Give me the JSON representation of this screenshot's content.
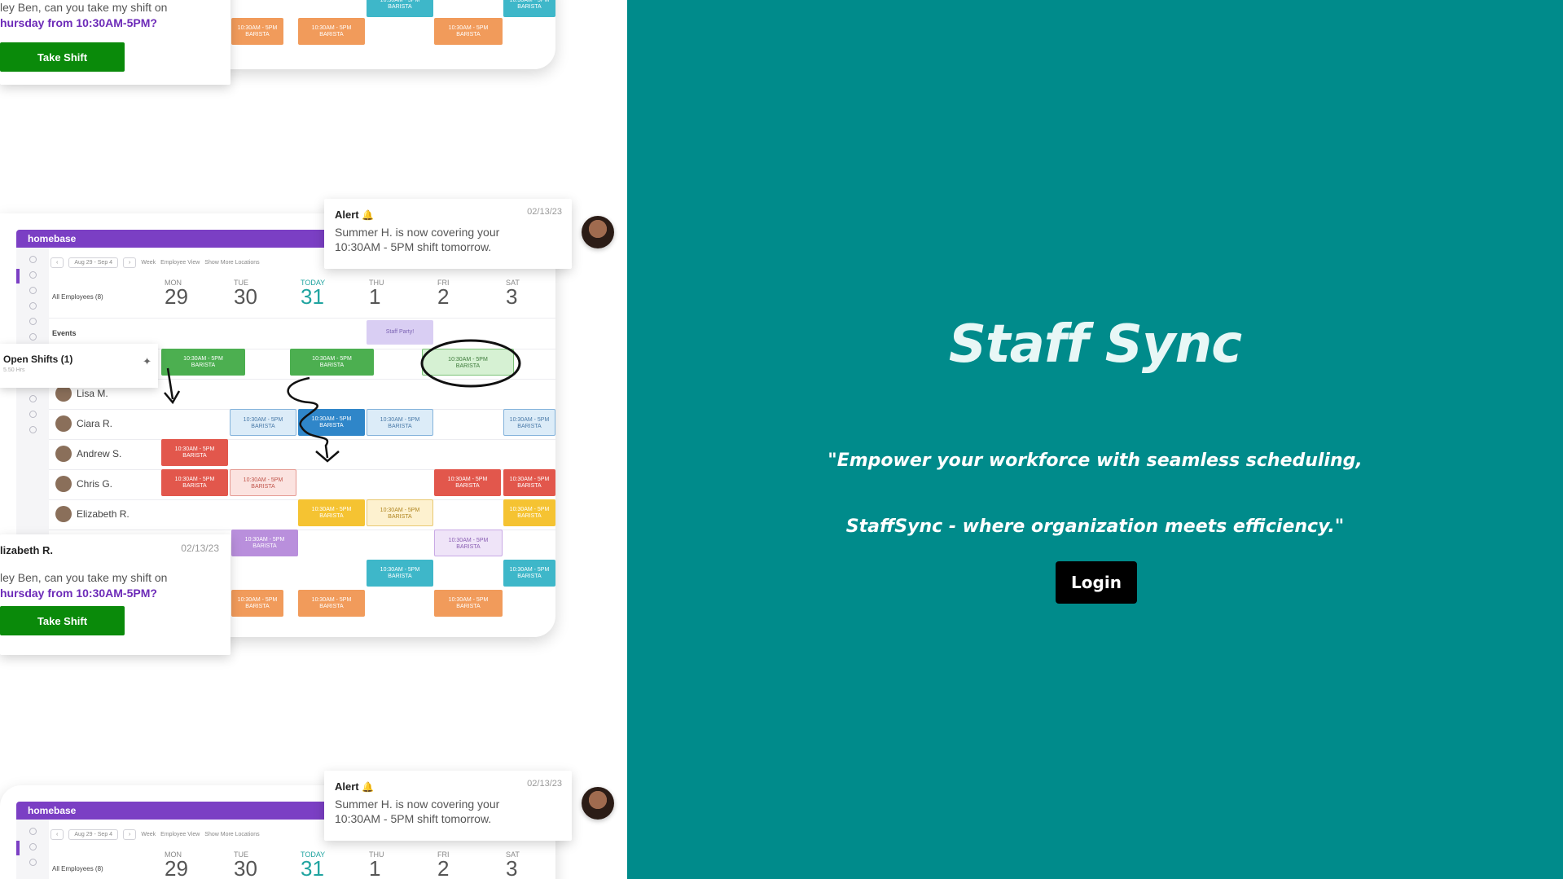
{
  "hero": {
    "title": "Staff Sync",
    "tagline_line1": "\"Empower your workforce with seamless scheduling,",
    "tagline_line2": "StaffSync - where organization meets efficiency.\"",
    "login_label": "Login"
  },
  "colors": {
    "hero_background": "#008b8b",
    "login_button": "#000000",
    "take_shift_button": "#0a8a0a",
    "homebase_brand": "#7b3fc4"
  },
  "collage": {
    "app_name": "homebase",
    "date_range": "Aug 29 - Sep 4",
    "view_week": "Week",
    "view_employee": "Employee View",
    "show_locations": "Show More Locations",
    "all_employees": "All Employees (8)",
    "events_label": "Events",
    "event_name": "Staff Party!",
    "open_shifts": "Open Shifts (1)",
    "open_shifts_hours": "5.50 Hrs",
    "days": [
      {
        "dow": "MON",
        "num": "29"
      },
      {
        "dow": "TUE",
        "num": "30"
      },
      {
        "dow": "TODAY",
        "num": "31"
      },
      {
        "dow": "THU",
        "num": "1"
      },
      {
        "dow": "FRI",
        "num": "2"
      },
      {
        "dow": "SAT",
        "num": "3"
      }
    ],
    "employees": [
      "Lisa M.",
      "Ciara R.",
      "Andrew S.",
      "Chris G.",
      "Elizabeth R."
    ],
    "shift_time": "10:30AM - 5PM",
    "shift_role": "BARISTA",
    "alert": {
      "title": "Alert",
      "date": "02/13/23",
      "body": "Summer H. is now covering your 10:30AM - 5PM shift tomorrow."
    },
    "message": {
      "sender": "lizabeth R.",
      "date": "02/13/23",
      "line1": "ley Ben, can you take my shift on",
      "line2": "hursday from 10:30AM-5PM?",
      "button": "Take Shift"
    }
  }
}
